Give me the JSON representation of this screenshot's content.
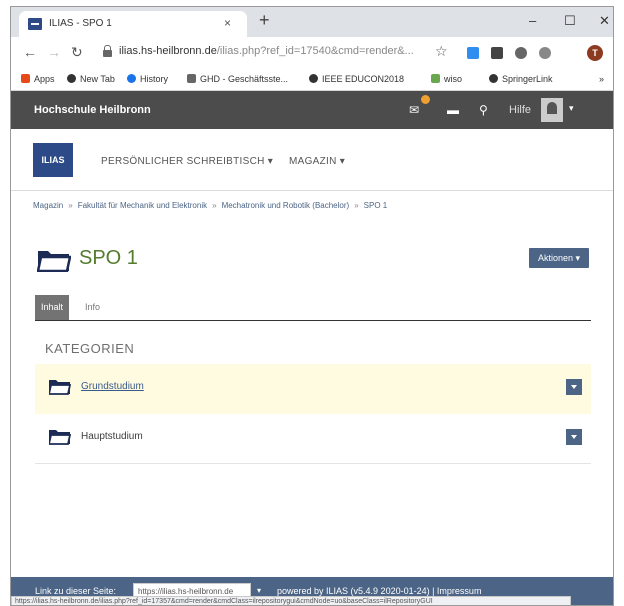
{
  "browser": {
    "tab_title": "ILIAS - SPO 1",
    "tab_close": "×",
    "new_tab": "+",
    "window_minimize": "–",
    "window_maximize": "☐",
    "window_close": "✕",
    "url_host": "ilias.hs-heilbronn.de",
    "url_path": "/ilias.php?ref_id=17540&cmd=render&...",
    "profile_initial": "T",
    "bookmarks": [
      {
        "label": "Apps",
        "color": "#e64a19"
      },
      {
        "label": "New Tab",
        "color": "#333333"
      },
      {
        "label": "History",
        "color": "#1a73e8"
      },
      {
        "label": "GHD - Geschäftsste...",
        "color": "#666666"
      },
      {
        "label": "IEEE EDUCON2018",
        "color": "#333333"
      },
      {
        "label": "wiso",
        "color": "#6aa84f"
      },
      {
        "label": "SpringerLink",
        "color": "#333333"
      }
    ],
    "bookmarks_more": "»",
    "status_url": "https://ilias.hs-heilbronn.de/ilias.php?ref_id=17357&cmd=render&cmdClass=ilrepositorygui&cmdNode=uo&baseClass=ilRepositoryGUI"
  },
  "header": {
    "institution": "Hochschule Heilbronn",
    "help_label": "Hilfe"
  },
  "nav": {
    "logo_text": "ILIAS",
    "items": [
      {
        "label": "PERSÖNLICHER SCHREIBTISCH ▾"
      },
      {
        "label": "MAGAZIN ▾"
      }
    ]
  },
  "breadcrumb": {
    "items": [
      "Magazin",
      "Fakultät für Mechanik und Elektronik",
      "Mechatronik und Robotik (Bachelor)",
      "SPO 1"
    ],
    "separator": "»"
  },
  "page": {
    "title": "SPO 1",
    "actions_label": "Aktionen ▾",
    "tabs": [
      {
        "label": "Inhalt",
        "active": true
      },
      {
        "label": "Info",
        "active": false
      }
    ]
  },
  "categories": {
    "heading": "KATEGORIEN",
    "items": [
      {
        "label": "Grundstudium",
        "highlighted": true
      },
      {
        "label": "Hauptstudium",
        "highlighted": false
      }
    ]
  },
  "footer": {
    "link_label": "Link zu dieser Seite:",
    "link_value": "https://ilias.hs-heilbronn.de",
    "powered_by": "powered by ILIAS (v5.4.9 2020-01-24) | Impressum"
  },
  "colors": {
    "header_bg": "#4c4c4c",
    "brand_blue": "#2b4a87",
    "title_green": "#557b2e",
    "action_blue": "#4c6586",
    "highlight_row": "#fffbe0"
  }
}
